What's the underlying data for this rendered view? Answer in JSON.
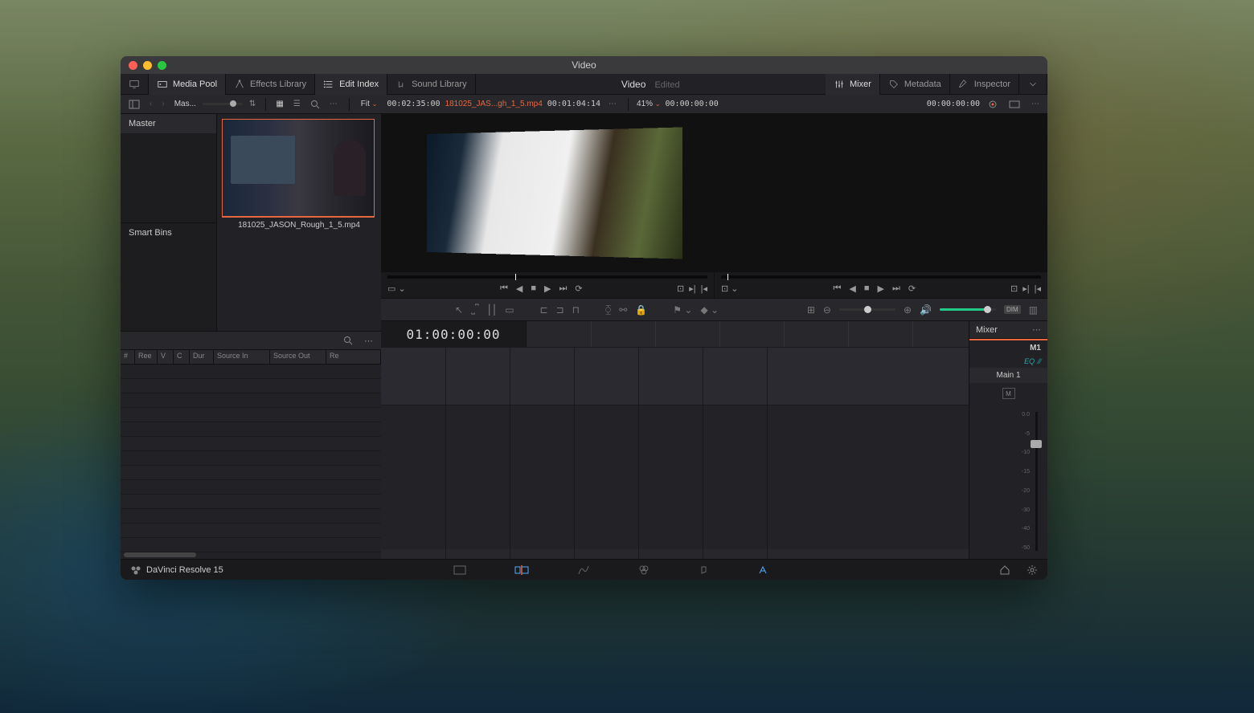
{
  "window": {
    "title": "Video"
  },
  "toolbar": {
    "media_pool": "Media Pool",
    "effects_library": "Effects Library",
    "edit_index": "Edit Index",
    "sound_library": "Sound Library",
    "center_title": "Video",
    "center_sub": "Edited",
    "mixer": "Mixer",
    "metadata": "Metadata",
    "inspector": "Inspector"
  },
  "sub": {
    "bin_label": "Mas...",
    "fit": "Fit",
    "src_duration": "00:02:35:00",
    "src_name": "181025_JAS...gh_1_5.mp4",
    "src_tc": "00:01:04:14",
    "zoom": "41%",
    "rec_tc_left": "00:00:00:00",
    "rec_tc_right": "00:00:00:00"
  },
  "bins": {
    "master": "Master",
    "smart": "Smart Bins",
    "clip_name": "181025_JASON_Rough_1_5.mp4"
  },
  "index": {
    "cols": [
      "#",
      "Ree",
      "V",
      "C",
      "Dur",
      "Source In",
      "Source Out",
      "Re"
    ]
  },
  "timeline": {
    "tc": "01:00:00:00"
  },
  "mixer": {
    "title": "Mixer",
    "strip": "M1",
    "eq": "EQ",
    "name": "Main 1",
    "mute": "M",
    "scale": [
      "0.0",
      "-5",
      "-10",
      "-15",
      "-20",
      "-30",
      "-40",
      "-50"
    ]
  },
  "tools": {
    "dim": "DIM"
  },
  "footer": {
    "app": "DaVinci Resolve 15"
  }
}
